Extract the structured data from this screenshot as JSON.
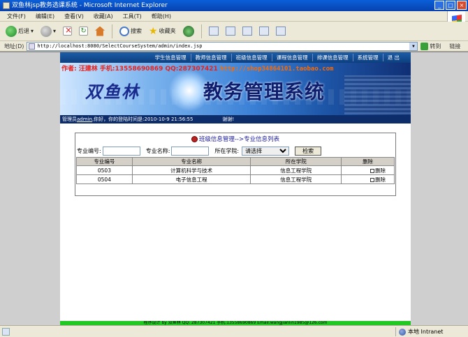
{
  "window": {
    "title": "双鱼林jsp教务选课系统 - Microsoft Internet Explorer",
    "controls": [
      "_",
      "□",
      "×"
    ]
  },
  "menu": [
    "文件(F)",
    "编辑(E)",
    "查看(V)",
    "收藏(A)",
    "工具(T)",
    "帮助(H)"
  ],
  "toolbar": {
    "back_label": "后退",
    "search_label": "搜索",
    "favorites_label": "收藏夹"
  },
  "address": {
    "label": "地址(D)",
    "url": "http://localhost:8080/SelectCourseSystem/admin/index.jsp",
    "go_label": "转到",
    "links_label": "链接"
  },
  "nav": {
    "items": [
      "学生信息管理",
      "教师信息管理",
      "班级信息管理",
      "课程信息管理",
      "排课信息管理",
      "系统管理",
      "退 出"
    ]
  },
  "banner": {
    "contact": "作者: 汪建林  手机:13558690869 QQ:287307421",
    "shop_url": "http://shop34864101.taobao.com",
    "brand": "双鱼林",
    "system_name": "教务管理系统"
  },
  "welcome": {
    "prefix": "管理员",
    "username": "admin",
    "message": ",你好，你的登陆时间是:2010-10-9 21:56:55",
    "thanks": "谢谢!"
  },
  "panel": {
    "title": "班级信息管理-->专业信息列表",
    "search": {
      "code_label": "专业编号:",
      "code_value": "",
      "name_label": "专业名称:",
      "name_value": "",
      "college_label": "所在学院:",
      "college_selected": "请选择",
      "button_label": "检索"
    },
    "columns": [
      "专业编号",
      "专业名称",
      "所在学院",
      "删除"
    ],
    "rows": [
      {
        "code": "0503",
        "name": "计算机科学与技术",
        "college": "信息工程学院",
        "action": "删除"
      },
      {
        "code": "0504",
        "name": "电子信息工程",
        "college": "信息工程学院",
        "action": "删除"
      }
    ]
  },
  "footer": {
    "text": "程序设计 by 双鱼林  QQ: 287307421 手机:13558690869 Email:wangjianlin1985@126.com"
  },
  "status": {
    "zone_label": "本地 Intranet"
  }
}
